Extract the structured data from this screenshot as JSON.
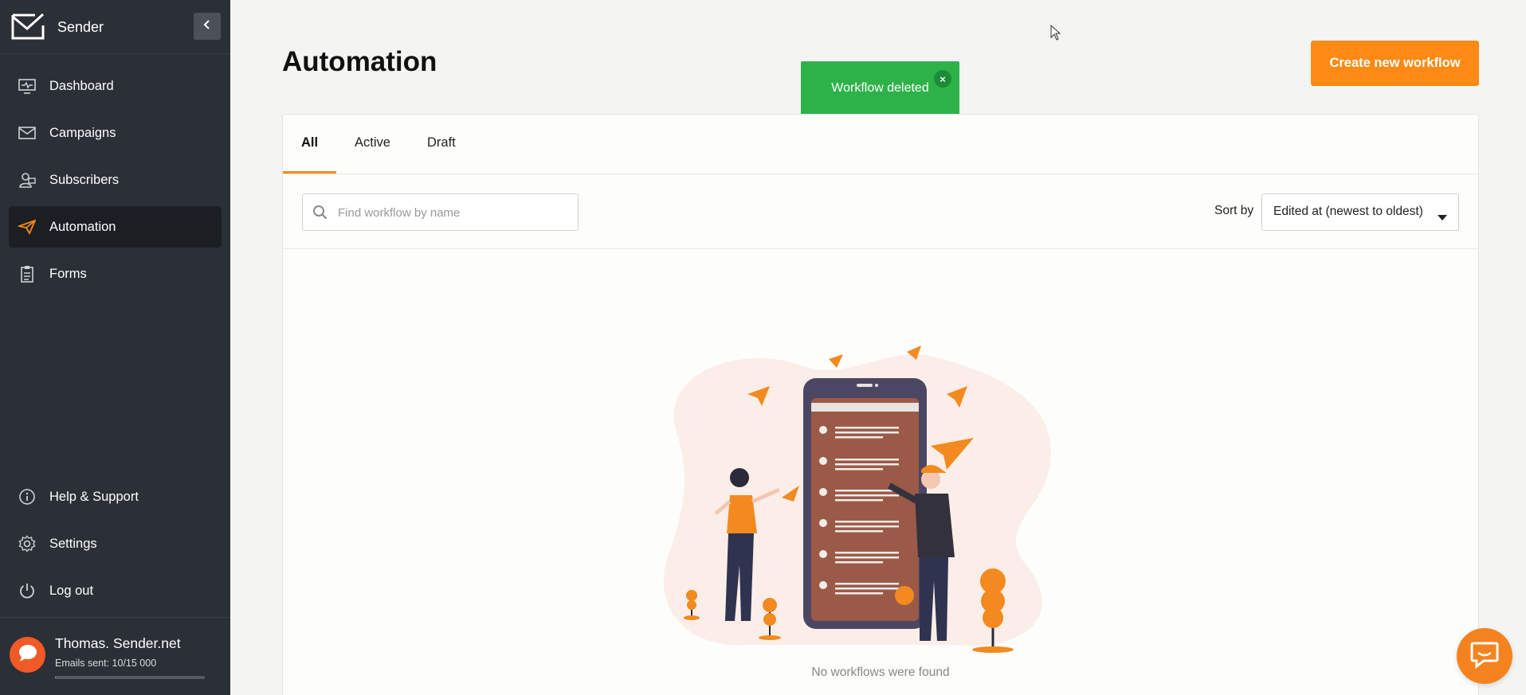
{
  "app": {
    "brand": "Sender"
  },
  "sidebar": {
    "items": [
      {
        "label": "Dashboard",
        "icon": "dashboard-icon"
      },
      {
        "label": "Campaigns",
        "icon": "envelope-icon"
      },
      {
        "label": "Subscribers",
        "icon": "subscribers-icon"
      },
      {
        "label": "Automation",
        "icon": "paper-plane-icon",
        "active": true
      },
      {
        "label": "Forms",
        "icon": "forms-icon"
      }
    ],
    "bottom_items": [
      {
        "label": "Help & Support",
        "icon": "info-icon"
      },
      {
        "label": "Settings",
        "icon": "gear-icon"
      },
      {
        "label": "Log out",
        "icon": "power-icon"
      }
    ],
    "user": {
      "name": "Thomas. Sender.net",
      "emails_sent": "Emails sent: 10/15 000",
      "usage_fraction": 0.0007
    }
  },
  "header": {
    "title": "Automation",
    "create_button": "Create new workflow"
  },
  "toast": {
    "message": "Workflow deleted",
    "close": "×"
  },
  "tabs": [
    {
      "label": "All",
      "active": true
    },
    {
      "label": "Active"
    },
    {
      "label": "Draft"
    }
  ],
  "search": {
    "placeholder": "Find workflow by name",
    "value": ""
  },
  "sort": {
    "label": "Sort by",
    "value": "Edited at (newest to oldest)"
  },
  "empty_state": {
    "text": "No workflows were found"
  },
  "colors": {
    "accent": "#fd8a15",
    "sidebar_bg": "#2b2f36",
    "toast_success": "#2db24a"
  }
}
